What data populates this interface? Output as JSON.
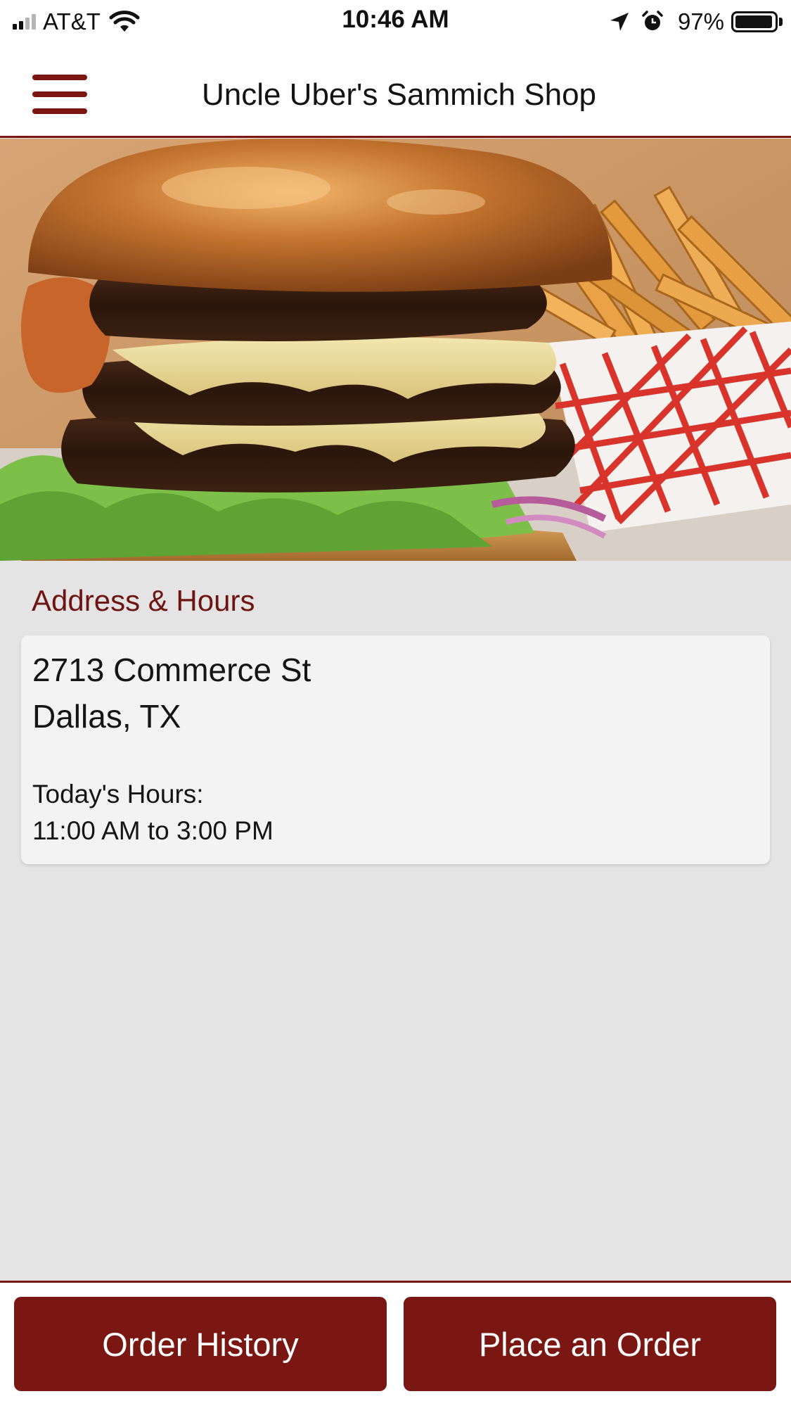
{
  "status_bar": {
    "carrier": "AT&T",
    "time": "10:46 AM",
    "battery_percent": "97%",
    "battery_level": 0.97,
    "signal_bars": 2,
    "icons": [
      "signal-icon",
      "wifi-icon",
      "location-arrow-icon",
      "alarm-icon",
      "battery-icon"
    ]
  },
  "header": {
    "title": "Uncle Uber's Sammich Shop",
    "menu_icon": "hamburger-menu-icon"
  },
  "hero": {
    "image": "burger-and-fries-photo"
  },
  "location": {
    "section_title": "Address & Hours",
    "address_line1": "2713 Commerce St",
    "address_line2": "Dallas, TX",
    "hours_label": "Today's Hours:",
    "hours_value": "11:00 AM to 3:00 PM"
  },
  "footer": {
    "order_history_label": "Order History",
    "place_order_label": "Place an Order"
  },
  "colors": {
    "brand": "#7a1712",
    "section_title": "#6e1512",
    "background": "#e4e4e4",
    "card": "#f3f3f3"
  }
}
